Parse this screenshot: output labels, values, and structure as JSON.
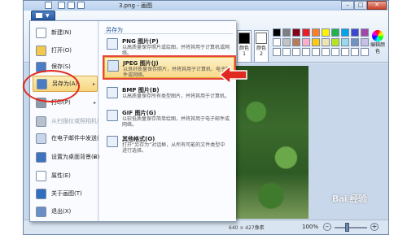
{
  "window": {
    "title": "3.png - 画图",
    "controls": {
      "minimize": "–",
      "maximize": "□",
      "close": "✕"
    }
  },
  "ribbon": {
    "color1_label": "颜色 1",
    "color2_label": "颜色 2",
    "edit_colors_label": "编辑颜色",
    "group_label": "颜色",
    "color1_value": "#000000",
    "color2_value": "#ffffff",
    "palette": [
      "#000000",
      "#7f7f7f",
      "#880015",
      "#ed1c24",
      "#ff7f27",
      "#fff200",
      "#22b14c",
      "#00a2e8",
      "#3f48cc",
      "#a349a4",
      "#ffffff",
      "#c3c3c3",
      "#b97a57",
      "#ffaec9",
      "#ffc90e",
      "#efe4b0",
      "#b5e61d",
      "#99d9ea",
      "#7092be",
      "#c8bfe7",
      "#ffffff",
      "#ffffff",
      "#ffffff",
      "#ffffff",
      "#ffffff",
      "#ffffff",
      "#ffffff",
      "#ffffff",
      "#ffffff",
      "#ffffff"
    ]
  },
  "app_menu": {
    "items": [
      {
        "label": "新建(N)",
        "icon": "new-file-icon",
        "color": "#ffffff"
      },
      {
        "label": "打开(O)",
        "icon": "open-folder-icon",
        "color": "#f2c94c"
      },
      {
        "label": "保存(S)",
        "icon": "save-disk-icon",
        "color": "#4a7bc4"
      },
      {
        "label": "另存为(A)",
        "icon": "save-as-icon",
        "color": "#4a7bc4",
        "has_submenu": true
      },
      {
        "label": "打印(P)",
        "icon": "printer-icon",
        "color": "#8f9aa8",
        "has_submenu": true
      },
      {
        "label": "从扫描仪或照相机(M)",
        "icon": "scanner-icon",
        "color": "#b7c0cc",
        "disabled": true
      },
      {
        "label": "在电子邮件中发送(D)",
        "icon": "email-icon",
        "color": "#c9d6ea"
      },
      {
        "label": "设置为桌面背景(B)",
        "icon": "desktop-icon",
        "color": "#3e73c0",
        "has_submenu": true
      },
      {
        "label": "属性(E)",
        "icon": "checkmark-icon",
        "color": "#ffffff"
      },
      {
        "label": "关于画图(T)",
        "icon": "info-icon",
        "color": "#2f6dc1"
      },
      {
        "label": "退出(X)",
        "icon": "exit-icon",
        "color": "#6b8fc4"
      }
    ],
    "submenu_title": "另存为",
    "formats": [
      {
        "name": "PNG 图片(P)",
        "desc": "以高质量保存照片或绘图，并将其用于计算机或网络。",
        "icon": "png-icon",
        "color": "#e9f0fa"
      },
      {
        "name": "JPEG 图片(J)",
        "desc": "以良好质量保存照片，并将其用于计算机、电子邮件或网络。",
        "icon": "jpeg-icon",
        "color": "#d8e6f7"
      },
      {
        "name": "BMP 图片(B)",
        "desc": "以高质量保存所有类型图片，并将其用于计算机。",
        "icon": "bmp-icon",
        "color": "#e9f0fa"
      },
      {
        "name": "GIF 图片(G)",
        "desc": "以较低质量保存简单绘图，并将其用于电子邮件或网络。",
        "icon": "gif-icon",
        "color": "#e9f0fa"
      },
      {
        "name": "其他格式(O)",
        "desc": "打开“另存为”对话框，从所有可能的文件类型中进行选择。",
        "icon": "other-format-icon",
        "color": "#e9f0fa"
      }
    ]
  },
  "status_bar": {
    "dimensions": "640 × 427像素",
    "zoom": "100%",
    "zoom_minus": "–",
    "zoom_plus": "+"
  },
  "watermark": "Bai 经验"
}
